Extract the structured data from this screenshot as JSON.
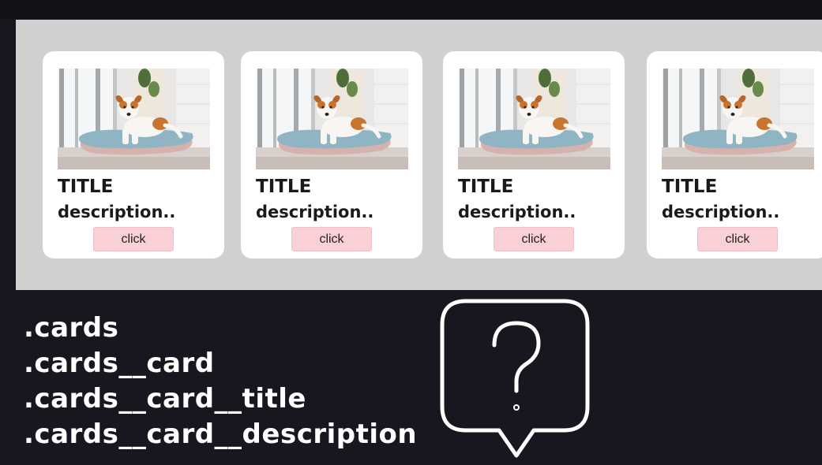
{
  "cards": [
    {
      "title": "TITLE",
      "description": "description..",
      "button_label": "click",
      "image_icon": "dog-on-pillow-photo"
    },
    {
      "title": "TITLE",
      "description": "description..",
      "button_label": "click",
      "image_icon": "dog-on-pillow-photo"
    },
    {
      "title": "TITLE",
      "description": "description..",
      "button_label": "click",
      "image_icon": "dog-on-pillow-photo"
    },
    {
      "title": "TITLE",
      "description": "description..",
      "button_label": "click",
      "image_icon": "dog-on-pillow-photo"
    }
  ],
  "code_lines": [
    ".cards",
    ".cards__card",
    ".cards__card__title",
    ".cards__card__description"
  ],
  "bubble": {
    "symbol": "?",
    "icon": "question-speech-bubble-icon"
  },
  "colors": {
    "background": "#171720",
    "preview_panel": "#d0d0d0",
    "card": "#ffffff",
    "button": "#f9d0d6",
    "code_text": "#ffffff"
  }
}
